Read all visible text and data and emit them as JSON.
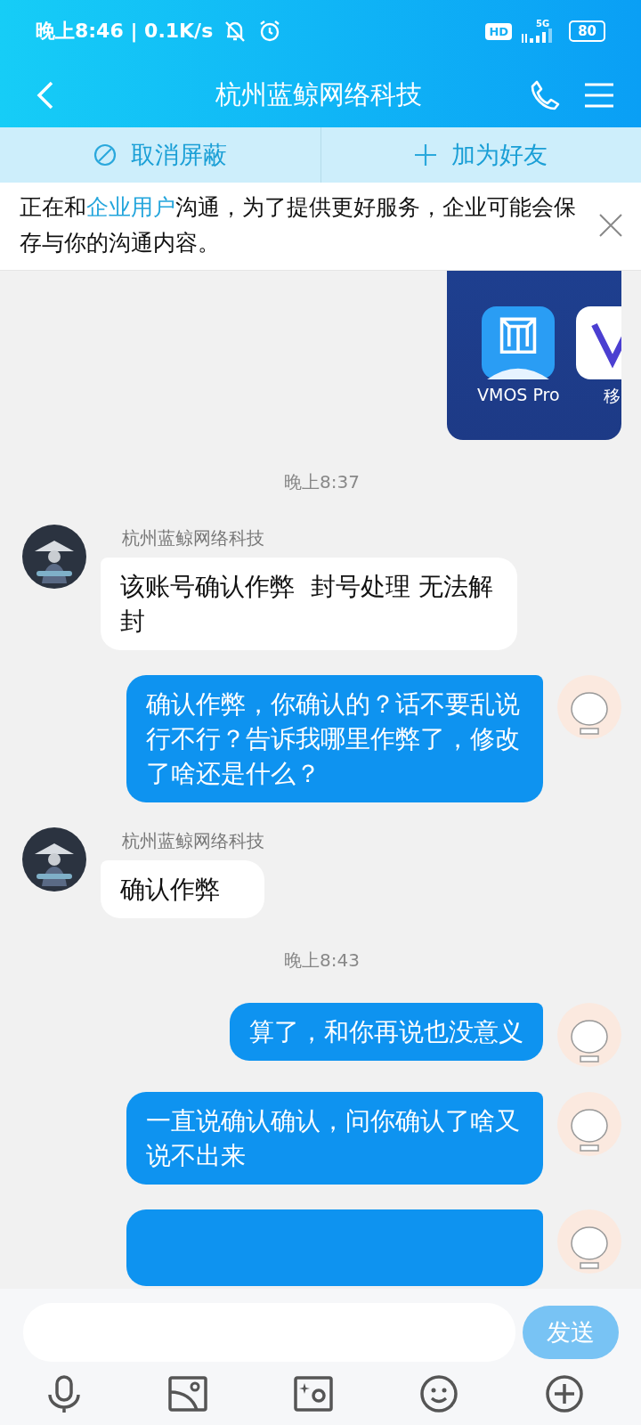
{
  "status_bar": {
    "time": "晚上8:46 | 0.1K/s",
    "hd": "HD",
    "network": "5G",
    "battery": "80"
  },
  "header": {
    "title": "杭州蓝鲸网络科技"
  },
  "actions": [
    {
      "label": "取消屏蔽"
    },
    {
      "label": "加为好友"
    }
  ],
  "notice": {
    "before": "正在和",
    "link": "企业用户",
    "after": "沟通，为了提供更好服务，企业可能会保存与你的沟通内容。"
  },
  "messages": [
    {
      "kind": "image",
      "apps": [
        "VMOS Pro",
        "移"
      ]
    },
    {
      "kind": "time",
      "text": "晚上8:37"
    },
    {
      "kind": "received",
      "name": "杭州蓝鲸网络科技",
      "text": "该账号确认作弊  封号处理 无法解封"
    },
    {
      "kind": "sent",
      "text": "确认作弊，你确认的？话不要乱说行不行？告诉我哪里作弊了，修改了啥还是什么？"
    },
    {
      "kind": "received",
      "name": "杭州蓝鲸网络科技",
      "text": "确认作弊"
    },
    {
      "kind": "time",
      "text": "晚上8:43"
    },
    {
      "kind": "sent",
      "text": "算了，和你再说也没意义"
    },
    {
      "kind": "sent",
      "text": "一直说确认确认，问你确认了啥又说不出来"
    },
    {
      "kind": "cut"
    }
  ],
  "composer": {
    "send": "发送"
  }
}
